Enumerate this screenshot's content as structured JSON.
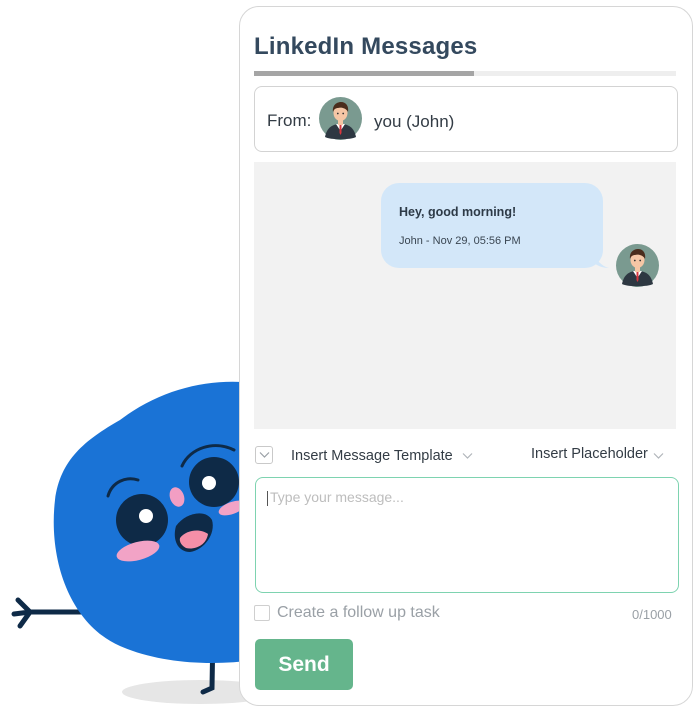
{
  "header": {
    "title": "LinkedIn Messages"
  },
  "from": {
    "label": "From:",
    "name": "you (John)",
    "avatar_icon": "user-avatar-icon"
  },
  "chat": {
    "messages": [
      {
        "text": "Hey, good morning!",
        "meta": "John - Nov 29, 05:56 PM"
      }
    ]
  },
  "composer": {
    "template_label": "Insert Message Template",
    "placeholder_label": "Insert Placeholder",
    "message_placeholder": "Type your message...",
    "follow_up_label": "Create a follow up task",
    "char_count": "0/1000",
    "send_label": "Send"
  },
  "colors": {
    "accent": "#65b58c",
    "bubble": "#d3e7f9",
    "mascot": "#1a73d6",
    "input_border": "#7ed3b0",
    "title": "#34495e"
  }
}
